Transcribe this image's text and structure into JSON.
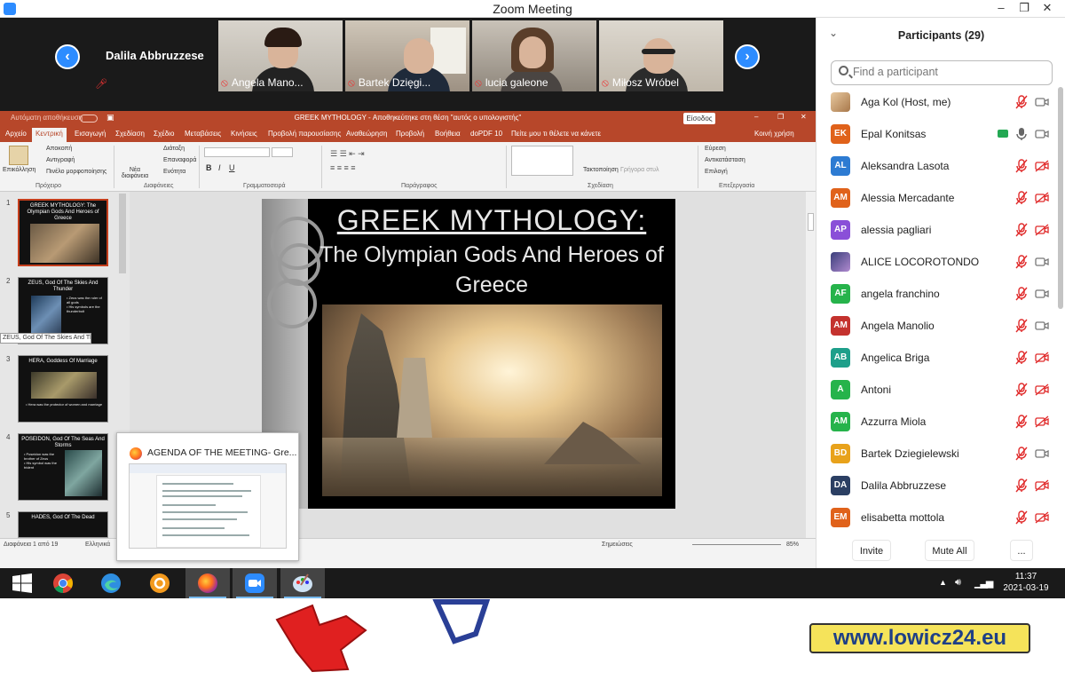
{
  "window": {
    "title": "Zoom Meeting"
  },
  "strip": {
    "spotlight": "Dalila Abbruzzese",
    "tiles": [
      {
        "name": "Angela Mano..."
      },
      {
        "name": "Bartek Dzięgi..."
      },
      {
        "name": "lucia galeone"
      },
      {
        "name": "Miłosz Wróbel"
      }
    ]
  },
  "ppt": {
    "title": "GREEK MYTHOLOGY - Αποθηκεύτηκε στη θέση \"αυτός ο υπολογιστής\"",
    "autosave": "Αυτόματη αποθήκευση",
    "signin": "Είσοδος",
    "menu": [
      "Αρχείο",
      "Κεντρική",
      "Εισαγωγή",
      "Σχεδίαση",
      "Σχέδιο",
      "Μεταβάσεις",
      "Κινήσεις",
      "Προβολή παρουσίασης",
      "Αναθεώρηση",
      "Προβολή",
      "Βοήθεια",
      "doPDF 10"
    ],
    "tellme": "Πείτε μου τι θέλετε να κάνετε",
    "share": "Κοινή χρήση",
    "ribbon": {
      "paste": "Επικόλληση",
      "cut": "Αποκοπή",
      "copy": "Αντιγραφή",
      "format_painter": "Πινέλο μορφοποίησης",
      "new_slide": "Νέα διαφάνεια",
      "layout": "Διάταξη",
      "reset": "Επαναφορά",
      "section": "Ενότητα",
      "arrange": "Τακτοποίηση",
      "quick_styles": "Γρήγορα στυλ",
      "find": "Εύρεση",
      "replace": "Αντικατάσταση",
      "select": "Επιλογή",
      "groups": [
        "Πρόχειρο",
        "Διαφάνειες",
        "Γραμματοσειρά",
        "Παράγραφος",
        "Σχεδίαση",
        "Επεξεργασία"
      ]
    },
    "slide": {
      "title": "GREEK MYTHOLOGY:",
      "subtitle": "The Olympian Gods And Heroes of Greece"
    },
    "thumbs": [
      {
        "num": "1",
        "title": "GREEK MYTHOLOGY: The Olympian Gods And Heroes of Greece"
      },
      {
        "num": "2",
        "title": "ZEUS, God Of The Skies And Thunder"
      },
      {
        "num": "3",
        "title": "HERA, Goddess Of Marriage"
      },
      {
        "num": "4",
        "title": "POSEIDON, God Of The Seas And Storms"
      },
      {
        "num": "5",
        "title": "HADES, God Of The Dead"
      }
    ],
    "tooltip": "ZEUS, God Of The Skies And Th...",
    "status": {
      "slide": "Διαφάνεια 1 από 19",
      "lang": "Ελληνικά",
      "notes": "Σημειώσεις",
      "zoom": "85%"
    }
  },
  "preview": {
    "title": "AGENDA OF THE MEETING- Gre..."
  },
  "panel": {
    "title": "Participants (29)",
    "search_placeholder": "Find a participant",
    "participants": [
      {
        "initials": "",
        "name": "Aga Kol (Host, me)",
        "color": "#c9a27a",
        "mic": "muted",
        "cam": "on"
      },
      {
        "initials": "EK",
        "name": "Epal Konitsas",
        "color": "#e0621b",
        "mic": "on",
        "cam": "on"
      },
      {
        "initials": "AL",
        "name": "Aleksandra Lasota",
        "color": "#2d7bd2",
        "mic": "muted",
        "cam": "off"
      },
      {
        "initials": "AM",
        "name": "Alessia Mercadante",
        "color": "#e0621b",
        "mic": "muted",
        "cam": "off"
      },
      {
        "initials": "AP",
        "name": "alessia pagliari",
        "color": "#8a4fd8",
        "mic": "muted",
        "cam": "off"
      },
      {
        "initials": "",
        "name": "ALICE LOCOROTONDO",
        "color": "#5a4b8a",
        "mic": "muted",
        "cam": "on"
      },
      {
        "initials": "AF",
        "name": "angela franchino",
        "color": "#26b34b",
        "mic": "muted",
        "cam": "on"
      },
      {
        "initials": "AM",
        "name": "Angela Manolio",
        "color": "#c4322e",
        "mic": "muted",
        "cam": "on"
      },
      {
        "initials": "AB",
        "name": "Angelica Briga",
        "color": "#1e9f8a",
        "mic": "muted",
        "cam": "off"
      },
      {
        "initials": "A",
        "name": "Antoni",
        "color": "#26b34b",
        "mic": "muted",
        "cam": "off"
      },
      {
        "initials": "AM",
        "name": "Azzurra Miola",
        "color": "#26b34b",
        "mic": "muted",
        "cam": "off"
      },
      {
        "initials": "BD",
        "name": "Bartek Dziegielewski",
        "color": "#e8a21b",
        "mic": "muted",
        "cam": "on"
      },
      {
        "initials": "DA",
        "name": "Dalila Abbruzzese",
        "color": "#2b3f63",
        "mic": "muted",
        "cam": "off"
      },
      {
        "initials": "EM",
        "name": "elisabetta mottola",
        "color": "#e0621b",
        "mic": "muted",
        "cam": "off"
      }
    ],
    "invite": "Invite",
    "mute_all": "Mute All",
    "more": "..."
  },
  "taskbar": {
    "time": "11:37",
    "date": "2021-03-19"
  },
  "watermark": "www.lowicz24.eu"
}
